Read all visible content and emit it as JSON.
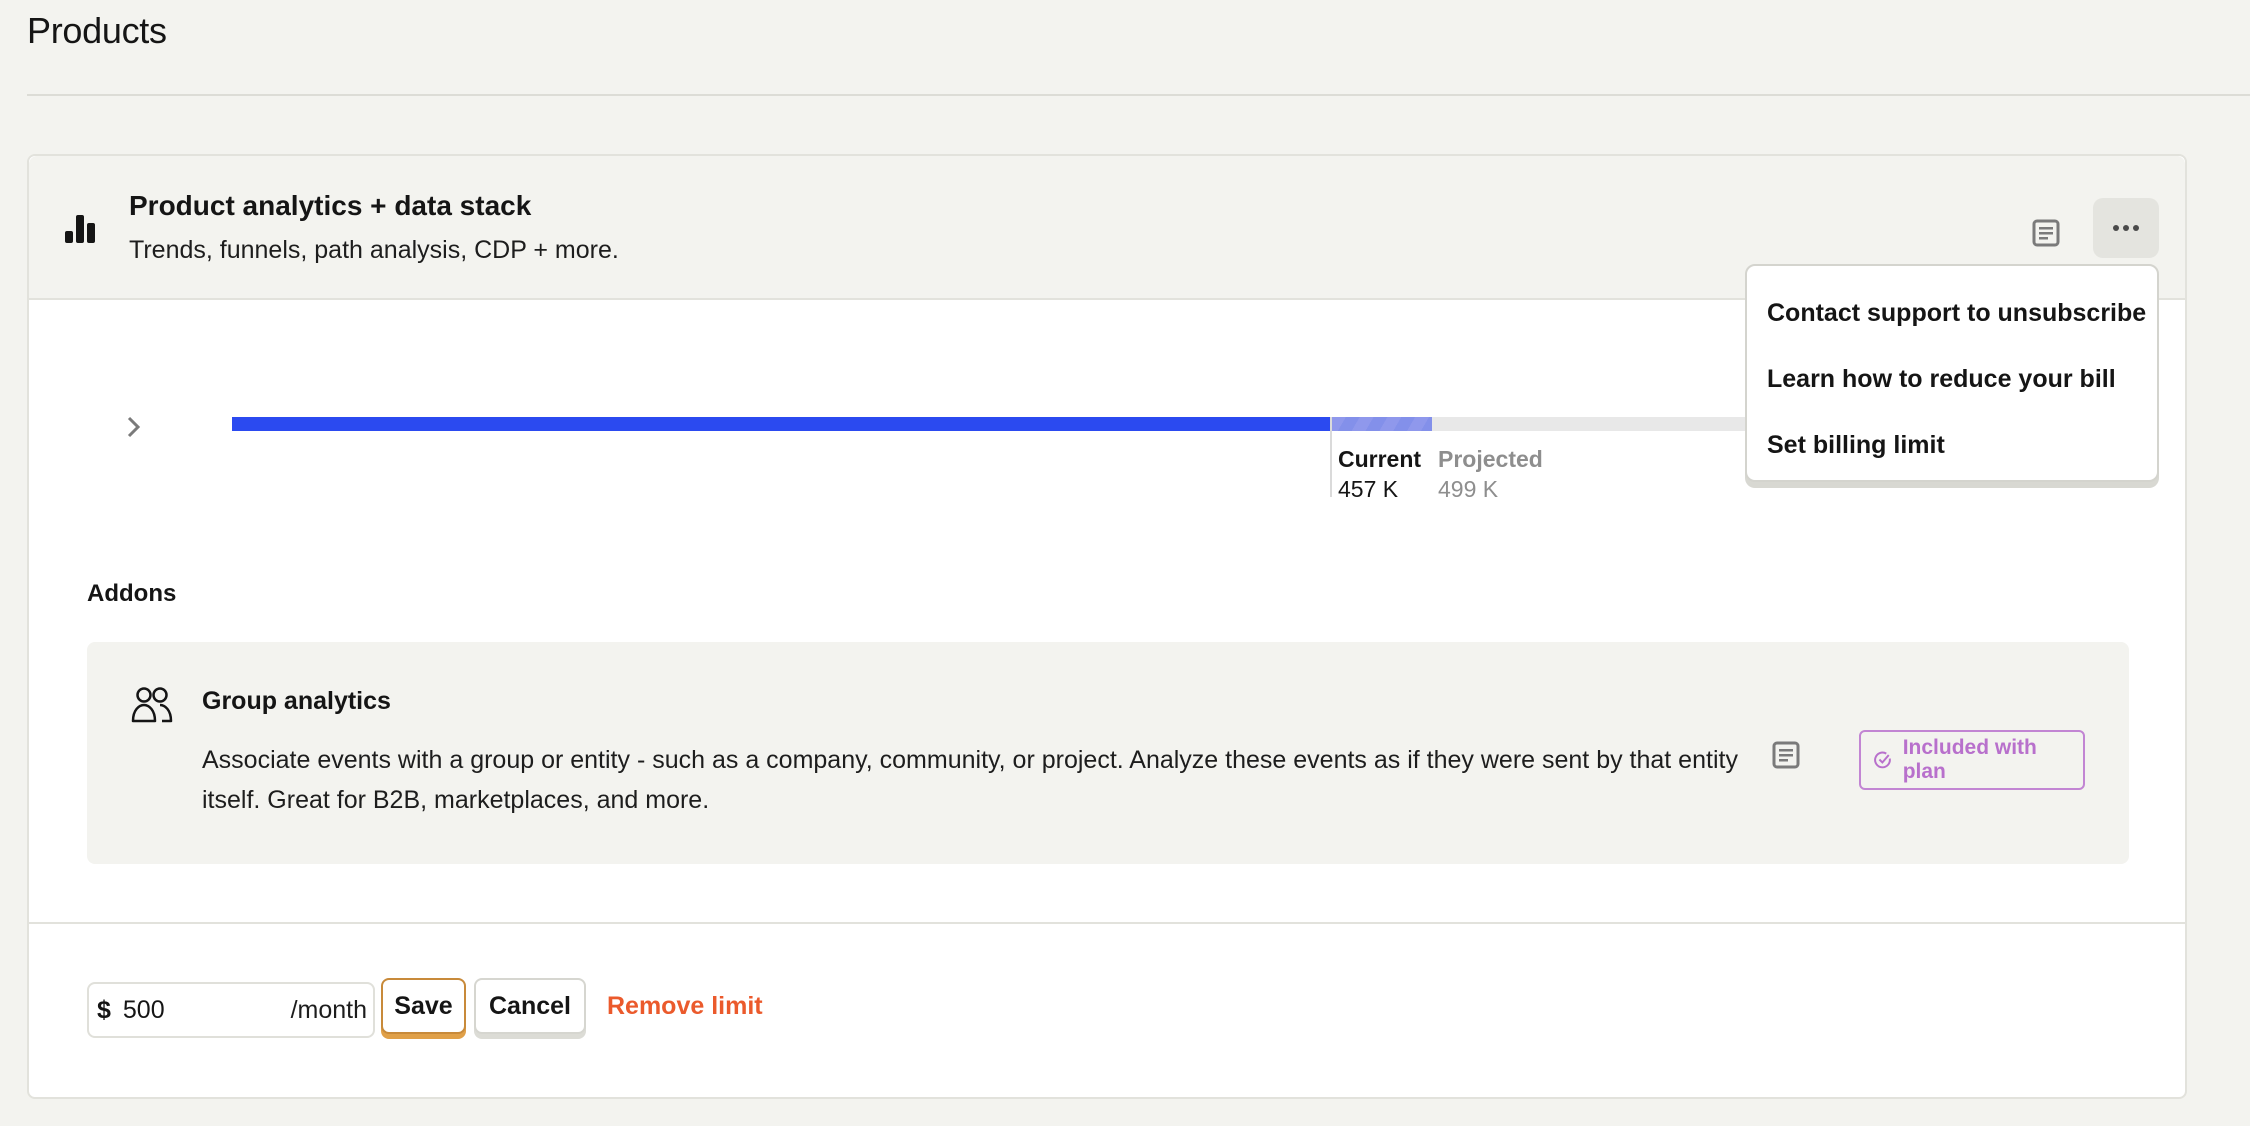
{
  "page": {
    "title": "Products"
  },
  "product": {
    "title": "Product analytics + data stack",
    "subtitle": "Trends, funnels, path analysis, CDP + more.",
    "icon": "bar-chart-icon",
    "actions": {
      "docs_icon": "document-icon",
      "more_icon": "more-horizontal-icon"
    },
    "menu": {
      "items": [
        {
          "label": "Contact support to unsubscribe"
        },
        {
          "label": "Learn how to reduce your bill"
        },
        {
          "label": "Set billing limit"
        }
      ]
    },
    "usage": {
      "current_label": "Current",
      "current_value": "457 K",
      "projected_label": "Projected",
      "projected_value": "499 K",
      "current_fraction": 0.572,
      "projected_fraction": 0.625,
      "colors": {
        "current": "#2b4af0",
        "projected": "#8f98ec",
        "track": "#e8e8e8"
      }
    }
  },
  "addons": {
    "title": "Addons",
    "items": [
      {
        "icon": "people-icon",
        "title": "Group analytics",
        "description": "Associate events with a group or entity - such as a company, community, or project. Analyze these events as if they were sent by that entity itself. Great for B2B, marketplaces, and more.",
        "badge": "Included with plan",
        "badge_color": "#b870cc"
      }
    ]
  },
  "billing_limit": {
    "currency": "$",
    "value": "500",
    "suffix": "/month",
    "save_label": "Save",
    "cancel_label": "Cancel",
    "remove_label": "Remove limit",
    "remove_color": "#eb5a2c"
  }
}
